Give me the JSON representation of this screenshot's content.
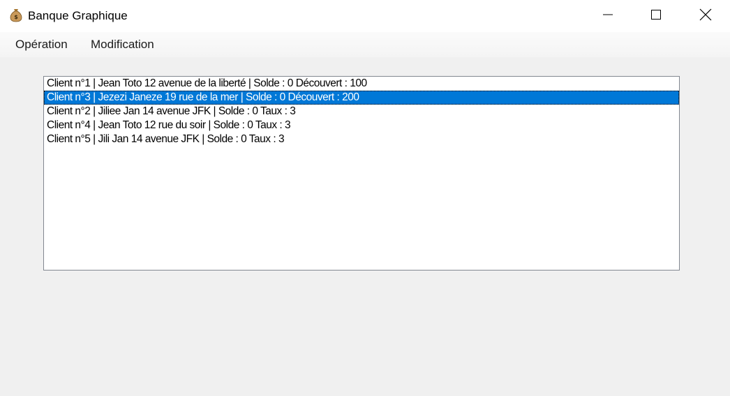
{
  "window": {
    "title": "Banque Graphique",
    "app_icon": "money-bag-icon",
    "controls": {
      "minimize_icon": "minimize-icon",
      "maximize_icon": "maximize-icon",
      "close_icon": "close-icon"
    }
  },
  "menubar": {
    "items": [
      {
        "label": "Opération"
      },
      {
        "label": "Modification"
      }
    ]
  },
  "client_list": {
    "selected_index": 1,
    "items": [
      {
        "text": "Client n°1 | Jean Toto 12 avenue de la liberté | Solde : 0 Découvert : 100"
      },
      {
        "text": "Client n°3 | Jezezi Janeze 19 rue de la mer | Solde : 0 Découvert : 200"
      },
      {
        "text": "Client n°2 | Jiliee Jan 14 avenue JFK | Solde : 0 Taux : 3"
      },
      {
        "text": "Client n°4 | Jean Toto 12 rue du soir | Solde : 0 Taux : 3"
      },
      {
        "text": "Client n°5 | Jili Jan 14 avenue JFK | Solde : 0 Taux : 3"
      }
    ]
  },
  "colors": {
    "selection": "#0078d7",
    "window_background": "#f0f0f0"
  }
}
